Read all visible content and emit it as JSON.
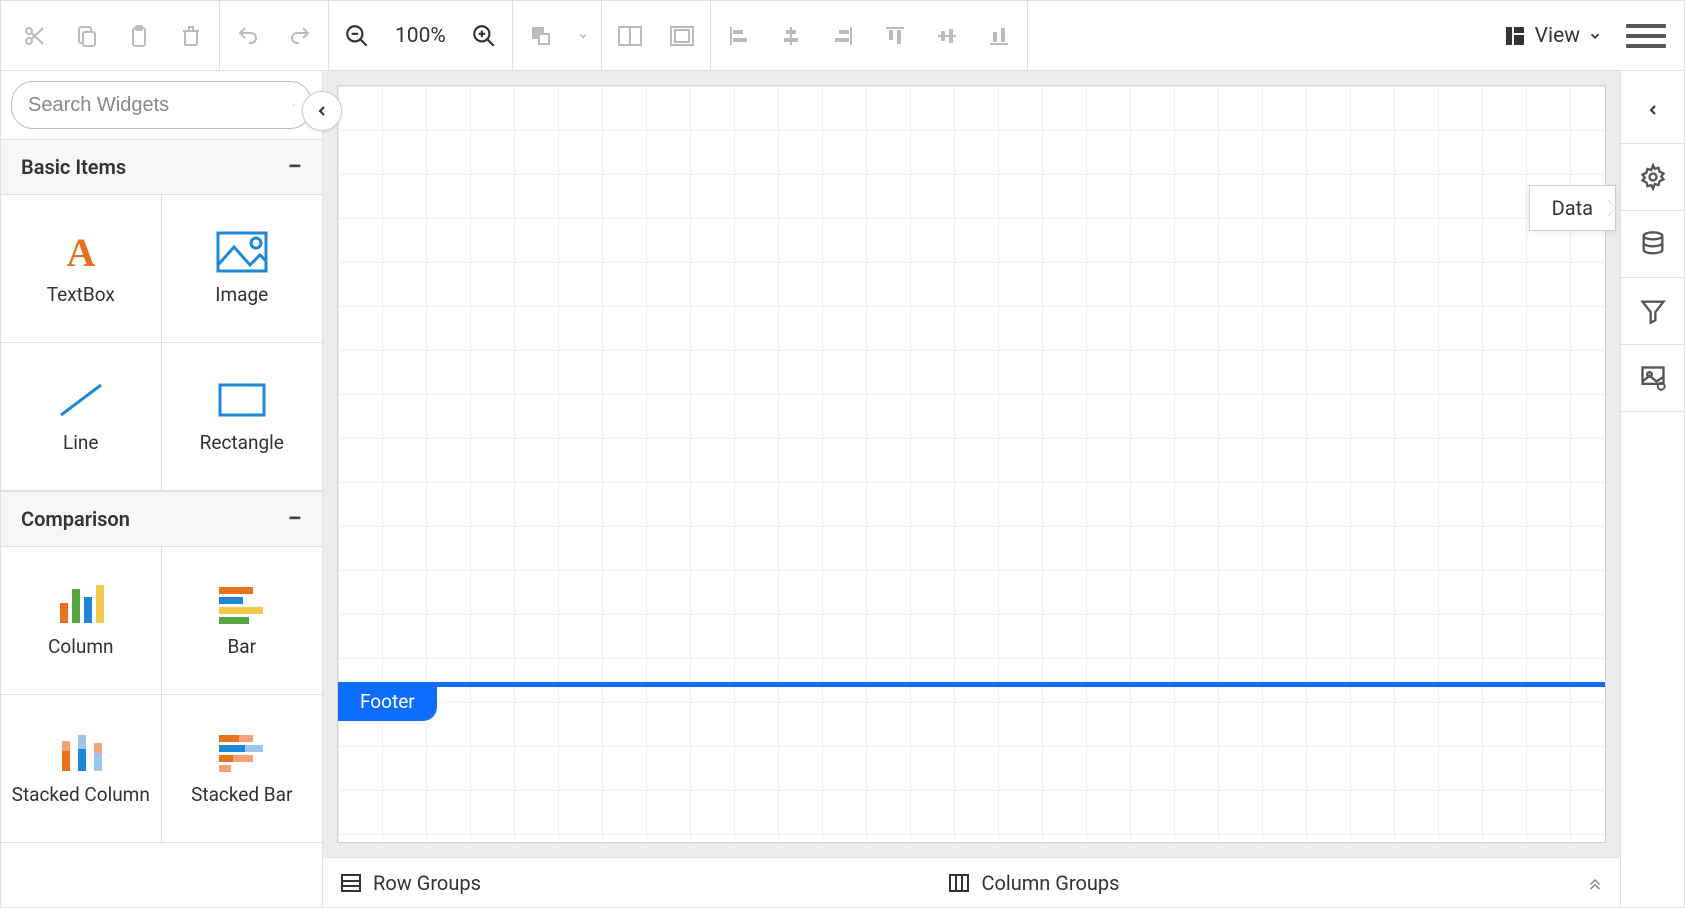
{
  "toolbar": {
    "zoom_label": "100%",
    "view_label": "View"
  },
  "sidebar": {
    "search_placeholder": "Search Widgets",
    "sections": {
      "basic": {
        "title": "Basic Items",
        "items": [
          "TextBox",
          "Image",
          "Line",
          "Rectangle"
        ]
      },
      "comparison": {
        "title": "Comparison",
        "items": [
          "Column",
          "Bar",
          "Stacked Column",
          "Stacked Bar"
        ]
      }
    }
  },
  "canvas": {
    "footer_label": "Footer"
  },
  "bottom": {
    "row_groups": "Row Groups",
    "column_groups": "Column Groups"
  },
  "rightbar": {
    "tooltip": "Data"
  }
}
